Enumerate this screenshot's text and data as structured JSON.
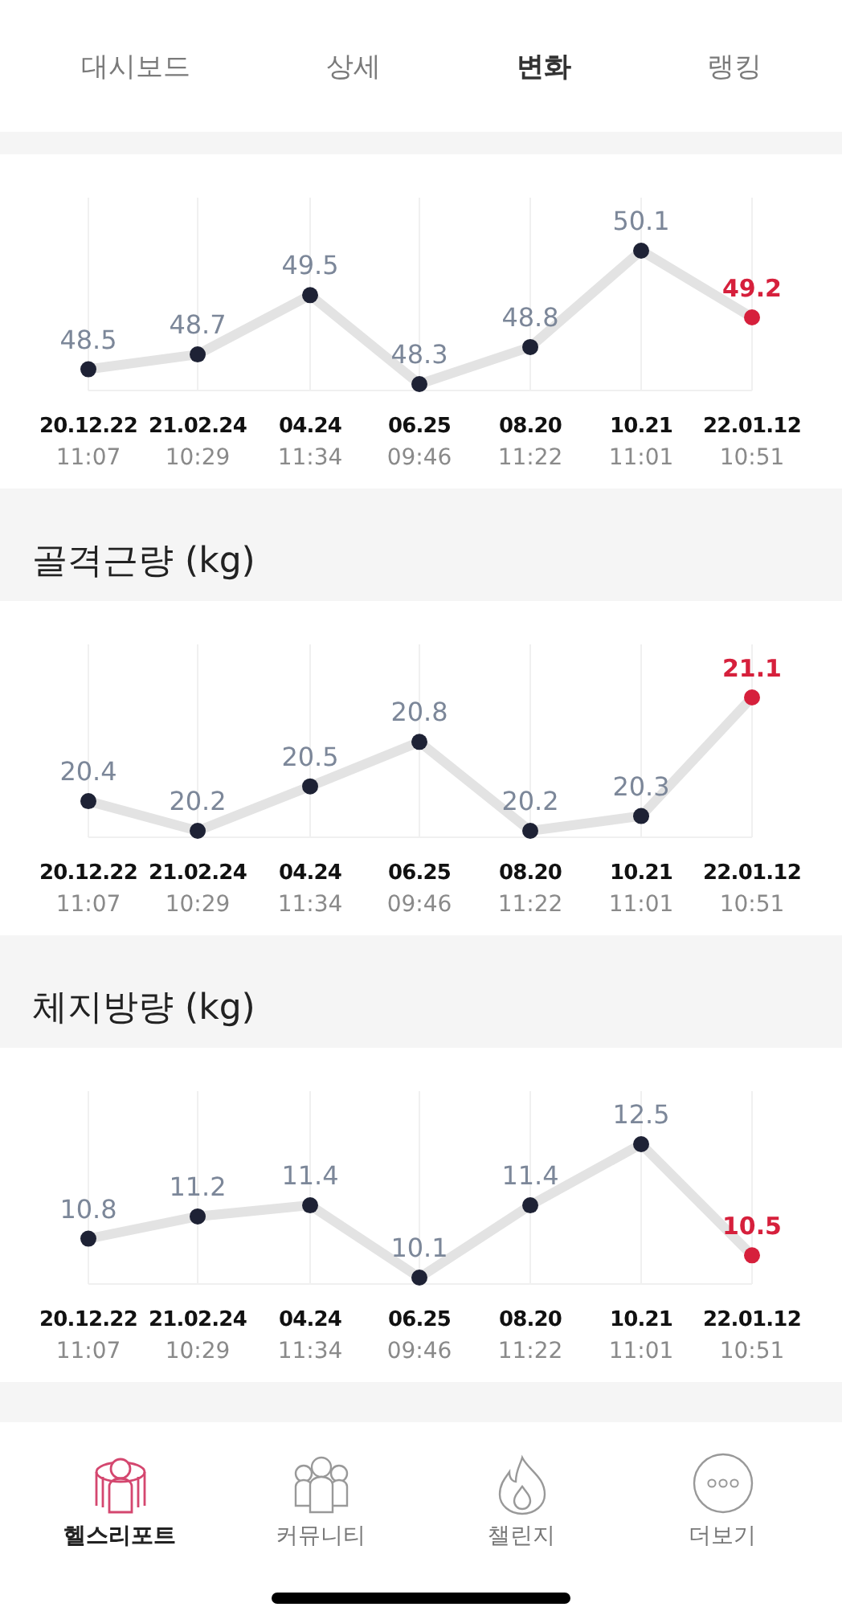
{
  "tabs": [
    {
      "label": "대시보드",
      "selected": false
    },
    {
      "label": "상세",
      "selected": false
    },
    {
      "label": "변화",
      "selected": true
    },
    {
      "label": "랭킹",
      "selected": false
    }
  ],
  "sections": [
    {
      "latest_highlighted": true,
      "times": [
        "11:07",
        "10:29",
        "11:34",
        "09:46",
        "11:22",
        "11:01",
        "10:51"
      ],
      "chart_data": {
        "type": "line",
        "categories": [
          "20.12.22",
          "21.02.24",
          "04.24",
          "06.25",
          "08.20",
          "10.21",
          "22.01.12"
        ],
        "values": [
          48.5,
          48.7,
          49.5,
          48.3,
          48.8,
          50.1,
          49.2
        ],
        "data_labels": true,
        "grid": true,
        "marker": true
      }
    },
    {
      "title": "골격근량 (kg)",
      "latest_highlighted": true,
      "times": [
        "11:07",
        "10:29",
        "11:34",
        "09:46",
        "11:22",
        "11:01",
        "10:51"
      ],
      "chart_data": {
        "type": "line",
        "categories": [
          "20.12.22",
          "21.02.24",
          "04.24",
          "06.25",
          "08.20",
          "10.21",
          "22.01.12"
        ],
        "values": [
          20.4,
          20.2,
          20.5,
          20.8,
          20.2,
          20.3,
          21.1
        ],
        "data_labels": true,
        "grid": true,
        "marker": true
      }
    },
    {
      "title": "체지방량 (kg)",
      "latest_highlighted": true,
      "times": [
        "11:07",
        "10:29",
        "11:34",
        "09:46",
        "11:22",
        "11:01",
        "10:51"
      ],
      "chart_data": {
        "type": "line",
        "categories": [
          "20.12.22",
          "21.02.24",
          "04.24",
          "06.25",
          "08.20",
          "10.21",
          "22.01.12"
        ],
        "values": [
          10.8,
          11.2,
          11.4,
          10.1,
          11.4,
          12.5,
          10.5
        ],
        "data_labels": true,
        "grid": true,
        "marker": true
      }
    }
  ],
  "bottom_nav": [
    {
      "kind": "report",
      "label": "헬스리포트",
      "selected": true
    },
    {
      "kind": "community",
      "label": "커뮤니티",
      "selected": false
    },
    {
      "kind": "challenge",
      "label": "챌린지",
      "selected": false
    },
    {
      "kind": "more",
      "label": "더보기",
      "selected": false
    }
  ]
}
